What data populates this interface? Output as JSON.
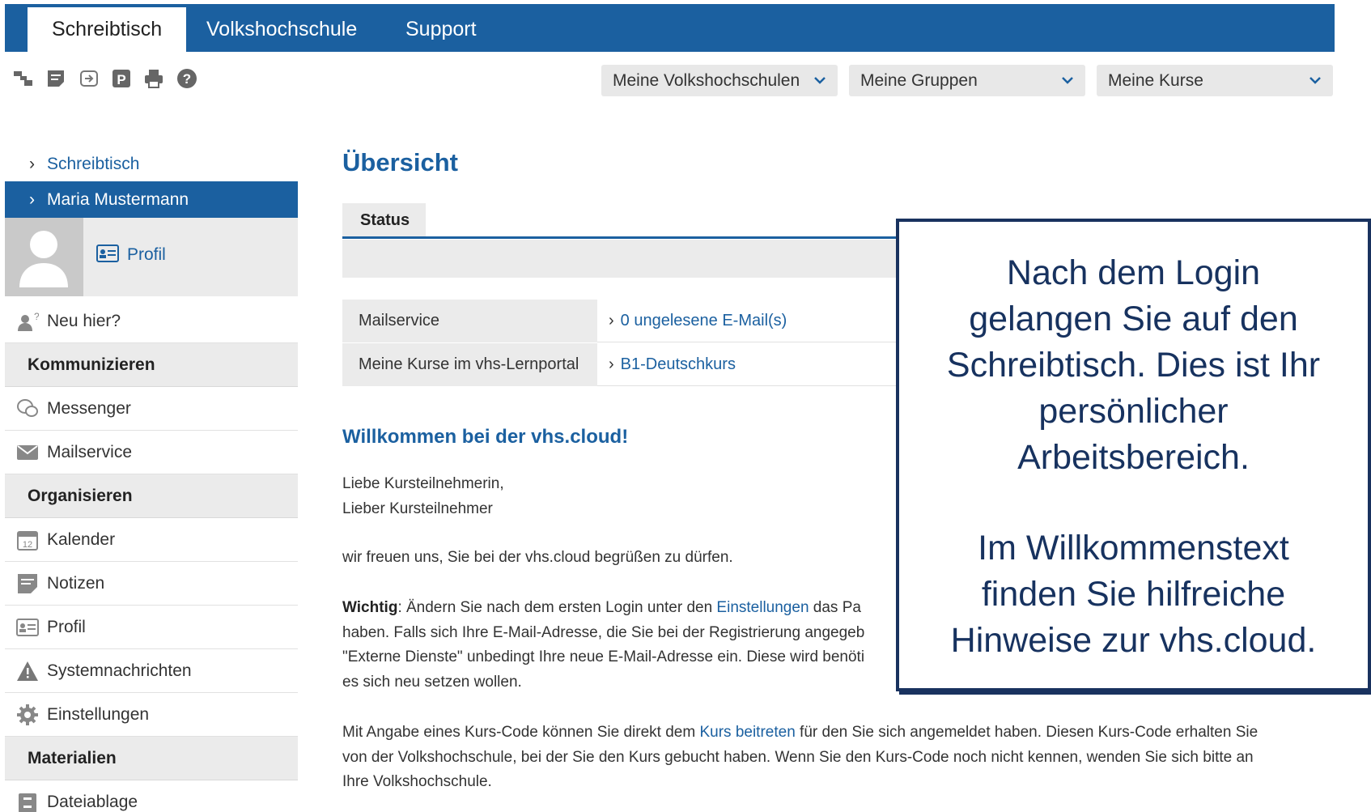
{
  "topnav": {
    "tabs": [
      {
        "label": "Schreibtisch",
        "active": true
      },
      {
        "label": "Volkshochschule",
        "active": false
      },
      {
        "label": "Support",
        "active": false
      }
    ]
  },
  "toolbar_icons": [
    "tree-icon",
    "notes-icon",
    "login-icon",
    "parking-icon",
    "print-icon",
    "help-icon"
  ],
  "dropdowns": {
    "volkshochschulen": "Meine Volkshochschulen",
    "gruppen": "Meine Gruppen",
    "kurse": "Meine Kurse"
  },
  "sidebar": {
    "breadcrumb": "Schreibtisch",
    "user": "Maria Mustermann",
    "profile_link": "Profil",
    "neu_hier": "Neu hier?",
    "sections": {
      "kommunizieren": "Kommunizieren",
      "organisieren": "Organisieren",
      "materialien": "Materialien"
    },
    "items": {
      "messenger": "Messenger",
      "mailservice": "Mailservice",
      "kalender": "Kalender",
      "notizen": "Notizen",
      "profil": "Profil",
      "systemnachrichten": "Systemnachrichten",
      "einstellungen": "Einstellungen",
      "dateiablage": "Dateiablage"
    }
  },
  "main": {
    "title": "Übersicht",
    "status_tab": "Status",
    "info_rows": [
      {
        "label": "Mailservice",
        "value": "0 ungelesene E-Mail(s)"
      },
      {
        "label": "Meine Kurse im vhs-Lernportal",
        "value": "B1-Deutschkurs"
      }
    ],
    "welcome_title": "Willkommen bei der vhs.cloud!",
    "greeting_1": "Liebe Kursteilnehmerin,",
    "greeting_2": "Lieber Kursteilnehmer",
    "intro": "wir freuen uns, Sie bei der vhs.cloud begrüßen zu dürfen.",
    "important_label": "Wichtig",
    "important_1a": ": Ändern Sie nach dem ersten Login unter den ",
    "important_link": "Einstellungen",
    "important_1b": " das Pa",
    "important_2": "haben. Falls sich Ihre E-Mail-Adresse, die Sie bei der Registrierung angegeb",
    "important_3": "\"Externe Dienste\" unbedingt Ihre neue E-Mail-Adresse ein. Diese wird benöti",
    "important_4": "es sich neu setzen wollen.",
    "course_1a": "Mit Angabe eines Kurs-Code können Sie direkt dem ",
    "course_link": "Kurs beitreten",
    "course_1b": " für den Sie sich angemeldet haben. Diesen Kurs-Code erhalten Sie",
    "course_2": "von der Volkshochschule, bei der Sie den Kurs gebucht haben. Wenn Sie den Kurs-Code noch nicht kennen, wenden Sie sich bitte an",
    "course_3": "Ihre Volkshochschule."
  },
  "callout": {
    "line1": "Nach dem Login",
    "line2": "gelangen Sie auf den",
    "line3": "Schreibtisch. Dies ist Ihr",
    "line4": "persönlicher",
    "line5": "Arbeitsbereich.",
    "line6": "Im Willkommenstext",
    "line7": "finden Sie hilfreiche",
    "line8": "Hinweise zur vhs.cloud."
  },
  "colors": {
    "brand": "#1b60a0",
    "callout_border": "#19325f",
    "panel_gray": "#ebebeb"
  }
}
